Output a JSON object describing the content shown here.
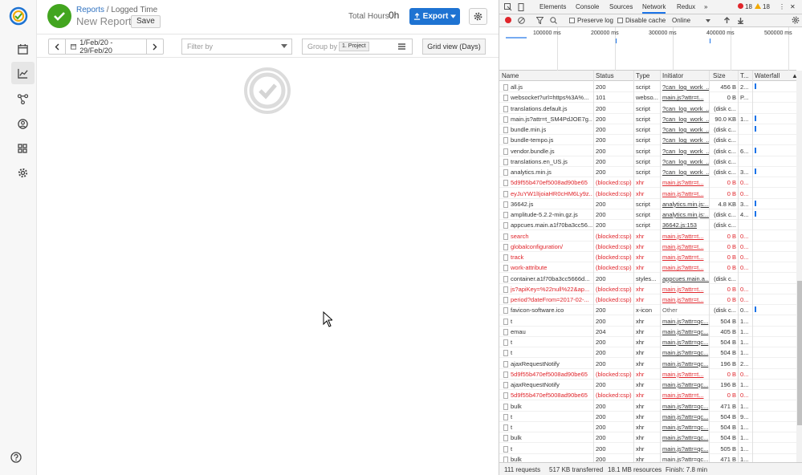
{
  "app": {
    "breadcrumb": {
      "parent": "Reports",
      "separator": " / ",
      "current": "Logged Time"
    },
    "report_title": "New Report",
    "save_label": "Save",
    "total_hours_label": "Total Hours",
    "total_hours_value": "0h",
    "export_label": "Export",
    "date_range": "1/Feb/20 - 29/Feb/20",
    "filter_placeholder": "Filter by",
    "group_by_label": "Group by",
    "group_by_tag": "1. Project",
    "grid_view_label": "Grid view (Days)"
  },
  "devtools": {
    "tabs": [
      "Elements",
      "Console",
      "Sources",
      "Network",
      "Redux"
    ],
    "active_tab": "Network",
    "more": "»",
    "errors": "18",
    "warnings": "18",
    "toolbar": {
      "preserve_log": "Preserve log",
      "disable_cache": "Disable cache",
      "throttle": "Online"
    },
    "overview_ticks": [
      "100000 ms",
      "200000 ms",
      "300000 ms",
      "400000 ms",
      "500000 ms"
    ],
    "columns": {
      "name": "Name",
      "status": "Status",
      "type": "Type",
      "initiator": "Initiator",
      "size": "Size",
      "time": "T...",
      "waterfall": "Waterfall"
    },
    "rows": [
      {
        "name": "all.js",
        "status": "200",
        "type": "script",
        "initiator": "?can_log_work_...",
        "size": "456 B",
        "time": "2...",
        "error": false
      },
      {
        "name": "websocket?url=https%3A%...",
        "status": "101",
        "type": "webso...",
        "initiator": "main.js?attr=t...",
        "size": "0 B",
        "time": "P...",
        "error": false
      },
      {
        "name": "translations.default.js",
        "status": "200",
        "type": "script",
        "initiator": "?can_log_work_...",
        "size": "(disk c...",
        "time": "",
        "error": false
      },
      {
        "name": "main.js?attr=t_SM4PdJOE7g...",
        "status": "200",
        "type": "script",
        "initiator": "?can_log_work_...",
        "size": "90.0 KB",
        "time": "1...",
        "error": false
      },
      {
        "name": "bundle.min.js",
        "status": "200",
        "type": "script",
        "initiator": "?can_log_work_...",
        "size": "(disk c...",
        "time": "",
        "error": false
      },
      {
        "name": "bundle-tempo.js",
        "status": "200",
        "type": "script",
        "initiator": "?can_log_work_...",
        "size": "(disk c...",
        "time": "",
        "error": false
      },
      {
        "name": "vendor.bundle.js",
        "status": "200",
        "type": "script",
        "initiator": "?can_log_work_...",
        "size": "(disk c...",
        "time": "6...",
        "error": false
      },
      {
        "name": "translations.en_US.js",
        "status": "200",
        "type": "script",
        "initiator": "?can_log_work_...",
        "size": "(disk c...",
        "time": "",
        "error": false
      },
      {
        "name": "analytics.min.js",
        "status": "200",
        "type": "script",
        "initiator": "?can_log_work_...",
        "size": "(disk c...",
        "time": "3...",
        "error": false
      },
      {
        "name": "5d9f55b470ef5008ad90be65",
        "status": "(blocked:csp)",
        "type": "xhr",
        "initiator": "main.js?attr=t...",
        "size": "0 B",
        "time": "0...",
        "error": true
      },
      {
        "name": "eyJuYW1lIjoiaHR0cHM6Ly9z...",
        "status": "(blocked:csp)",
        "type": "xhr",
        "initiator": "main.js?attr=t...",
        "size": "0 B",
        "time": "0...",
        "error": true
      },
      {
        "name": "36642.js",
        "status": "200",
        "type": "script",
        "initiator": "analytics.min.js:...",
        "size": "4.8 KB",
        "time": "3...",
        "error": false
      },
      {
        "name": "amplitude-5.2.2-min.gz.js",
        "status": "200",
        "type": "script",
        "initiator": "analytics.min.js:...",
        "size": "(disk c...",
        "time": "4...",
        "error": false
      },
      {
        "name": "appcues.main.a1f70ba3cc56...",
        "status": "200",
        "type": "script",
        "initiator": "36642.js:153",
        "size": "(disk c...",
        "time": "",
        "error": false
      },
      {
        "name": "search",
        "status": "(blocked:csp)",
        "type": "xhr",
        "initiator": "main.js?attr=t...",
        "size": "0 B",
        "time": "0...",
        "error": true
      },
      {
        "name": "globalconfiguration/",
        "status": "(blocked:csp)",
        "type": "xhr",
        "initiator": "main.js?attr=t...",
        "size": "0 B",
        "time": "0...",
        "error": true
      },
      {
        "name": "track",
        "status": "(blocked:csp)",
        "type": "xhr",
        "initiator": "main.js?attr=t...",
        "size": "0 B",
        "time": "0...",
        "error": true
      },
      {
        "name": "work-attribute",
        "status": "(blocked:csp)",
        "type": "xhr",
        "initiator": "main.js?attr=t...",
        "size": "0 B",
        "time": "0...",
        "error": true
      },
      {
        "name": "container.a1f70ba3cc5666d...",
        "status": "200",
        "type": "styles...",
        "initiator": "appcues.main.a...",
        "size": "(disk c...",
        "time": "",
        "error": false
      },
      {
        "name": "js?apiKey=%22null%22&ap...",
        "status": "(blocked:csp)",
        "type": "xhr",
        "initiator": "main.js?attr=t...",
        "size": "0 B",
        "time": "0...",
        "error": true
      },
      {
        "name": "period?dateFrom=2017-02-...",
        "status": "(blocked:csp)",
        "type": "xhr",
        "initiator": "main.js?attr=t...",
        "size": "0 B",
        "time": "0...",
        "error": true
      },
      {
        "name": "favicon-software.ico",
        "status": "200",
        "type": "x-icon",
        "initiator": "Other",
        "size": "(disk c...",
        "time": "0...",
        "error": false
      },
      {
        "name": "t",
        "status": "200",
        "type": "xhr",
        "initiator": "main.js?attr=qc...",
        "size": "504 B",
        "time": "1...",
        "error": false
      },
      {
        "name": "emau",
        "status": "204",
        "type": "xhr",
        "initiator": "main.js?attr=qc...",
        "size": "405 B",
        "time": "1...",
        "error": false
      },
      {
        "name": "t",
        "status": "200",
        "type": "xhr",
        "initiator": "main.js?attr=qc...",
        "size": "504 B",
        "time": "1...",
        "error": false
      },
      {
        "name": "t",
        "status": "200",
        "type": "xhr",
        "initiator": "main.js?attr=qc...",
        "size": "504 B",
        "time": "1...",
        "error": false
      },
      {
        "name": "ajaxRequestNotify",
        "status": "200",
        "type": "xhr",
        "initiator": "main.js?attr=qc...",
        "size": "196 B",
        "time": "2...",
        "error": false
      },
      {
        "name": "5d9f55b470ef5008ad90be65",
        "status": "(blocked:csp)",
        "type": "xhr",
        "initiator": "main.js?attr=t...",
        "size": "0 B",
        "time": "0...",
        "error": true
      },
      {
        "name": "ajaxRequestNotify",
        "status": "200",
        "type": "xhr",
        "initiator": "main.js?attr=qc...",
        "size": "196 B",
        "time": "1...",
        "error": false
      },
      {
        "name": "5d9f55b470ef5008ad90be65",
        "status": "(blocked:csp)",
        "type": "xhr",
        "initiator": "main.js?attr=t...",
        "size": "0 B",
        "time": "0...",
        "error": true
      },
      {
        "name": "bulk",
        "status": "200",
        "type": "xhr",
        "initiator": "main.js?attr=qc...",
        "size": "471 B",
        "time": "1...",
        "error": false
      },
      {
        "name": "t",
        "status": "200",
        "type": "xhr",
        "initiator": "main.js?attr=qc...",
        "size": "504 B",
        "time": "9...",
        "error": false
      },
      {
        "name": "t",
        "status": "200",
        "type": "xhr",
        "initiator": "main.js?attr=qc...",
        "size": "504 B",
        "time": "1...",
        "error": false
      },
      {
        "name": "bulk",
        "status": "200",
        "type": "xhr",
        "initiator": "main.js?attr=qc...",
        "size": "504 B",
        "time": "1...",
        "error": false
      },
      {
        "name": "t",
        "status": "200",
        "type": "xhr",
        "initiator": "main.js?attr=qc...",
        "size": "505 B",
        "time": "1...",
        "error": false
      },
      {
        "name": "bulk",
        "status": "200",
        "type": "xhr",
        "initiator": "main.js?attr=qc...",
        "size": "471 B",
        "time": "1...",
        "error": false
      }
    ],
    "status_bar": {
      "requests": "111 requests",
      "transferred": "517 KB transferred",
      "resources": "18.1 MB resources",
      "finish": "Finish: 7.8 min"
    }
  },
  "colors": {
    "brand_green": "#42a51f",
    "export_blue": "#1e73d2",
    "error_red": "#e0252b",
    "link_blue": "#3173c1"
  }
}
